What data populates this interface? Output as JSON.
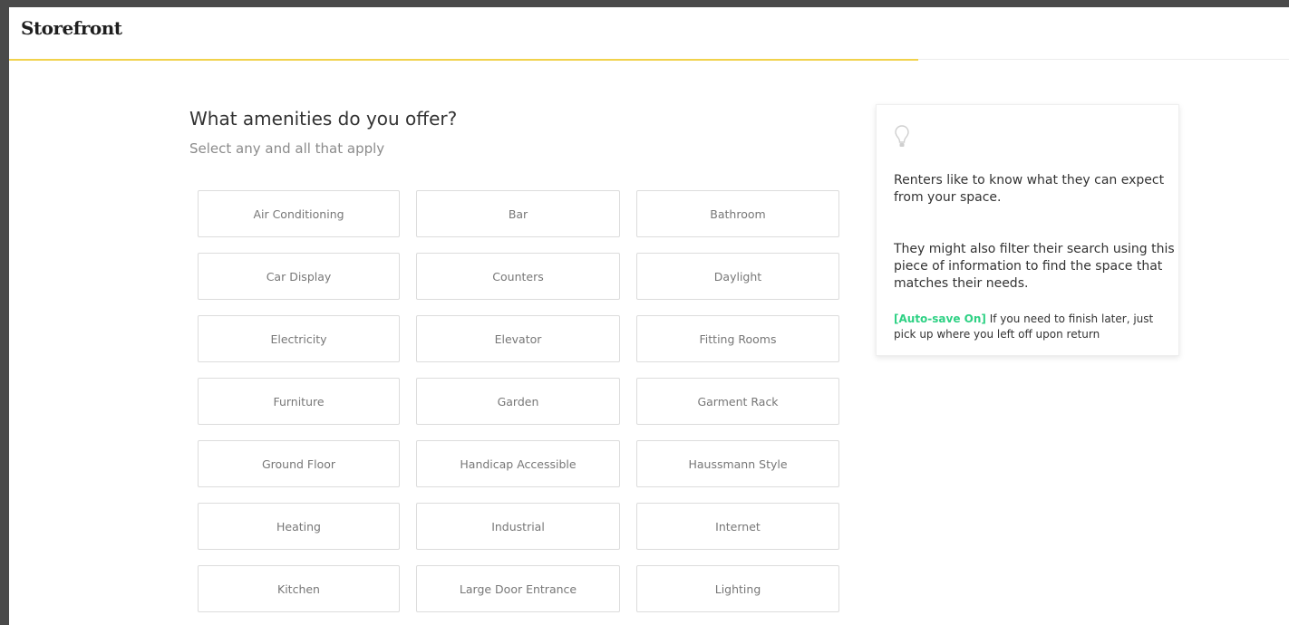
{
  "header": {
    "logo": "Storefront",
    "progress_fraction": 0.71
  },
  "main": {
    "title": "What amenities do you offer?",
    "subtitle": "Select any and all that apply",
    "amenities": [
      "Air Conditioning",
      "Bar",
      "Bathroom",
      "Car Display",
      "Counters",
      "Daylight",
      "Electricity",
      "Elevator",
      "Fitting Rooms",
      "Furniture",
      "Garden",
      "Garment Rack",
      "Ground Floor",
      "Handicap Accessible",
      "Haussmann Style",
      "Heating",
      "Industrial",
      "Internet",
      "Kitchen",
      "Large Door Entrance",
      "Lighting"
    ]
  },
  "tip": {
    "icon": "lightbulb-icon",
    "paragraph1": "Renters like to know what they can expect from your space.",
    "paragraph2": "They might also filter their search using this piece of information to find the space that matches their needs.",
    "autosave_tag": "[Auto-save On]",
    "autosave_text": " If you need to finish later, just pick up where you left off upon return"
  },
  "colors": {
    "accent_yellow": "#f1d24b",
    "autosave_green": "#2ed184"
  }
}
